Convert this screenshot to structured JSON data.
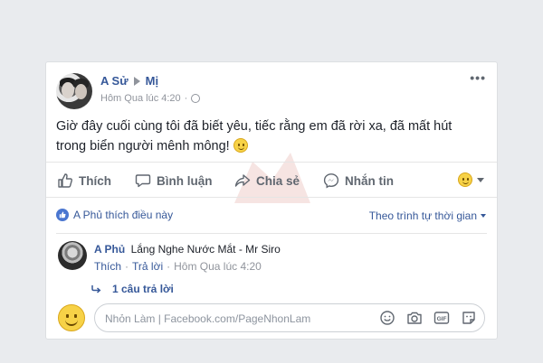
{
  "post": {
    "author": "A Sử",
    "target": "Mị",
    "time": "Hôm Qua lúc 4:20",
    "more_label": "•••",
    "text": "Giờ đây cuối cùng tôi đã biết yêu, tiếc rằng em đã rời xa, đã mất hút trong biển người mênh mông!"
  },
  "actions": {
    "like": "Thích",
    "comment": "Bình luận",
    "share": "Chia sẻ",
    "message": "Nhắn tin"
  },
  "reactions": {
    "likes_text": "A Phủ thích điều này",
    "sort_label": "Theo trình tự thời gian"
  },
  "comment": {
    "author": "A Phủ",
    "text": "Lắng Nghe Nước Mắt - Mr Siro",
    "like": "Thích",
    "reply": "Trả lời",
    "separator": "·",
    "time": "Hôm Qua lúc 4:20",
    "replies": "1 câu trả lời"
  },
  "composer": {
    "placeholder": "Nhỏn Làm | Facebook.com/PageNhonLam"
  },
  "colors": {
    "link": "#365899",
    "muted": "#90949c",
    "action": "#606770",
    "like_badge": "#4a76d0"
  }
}
